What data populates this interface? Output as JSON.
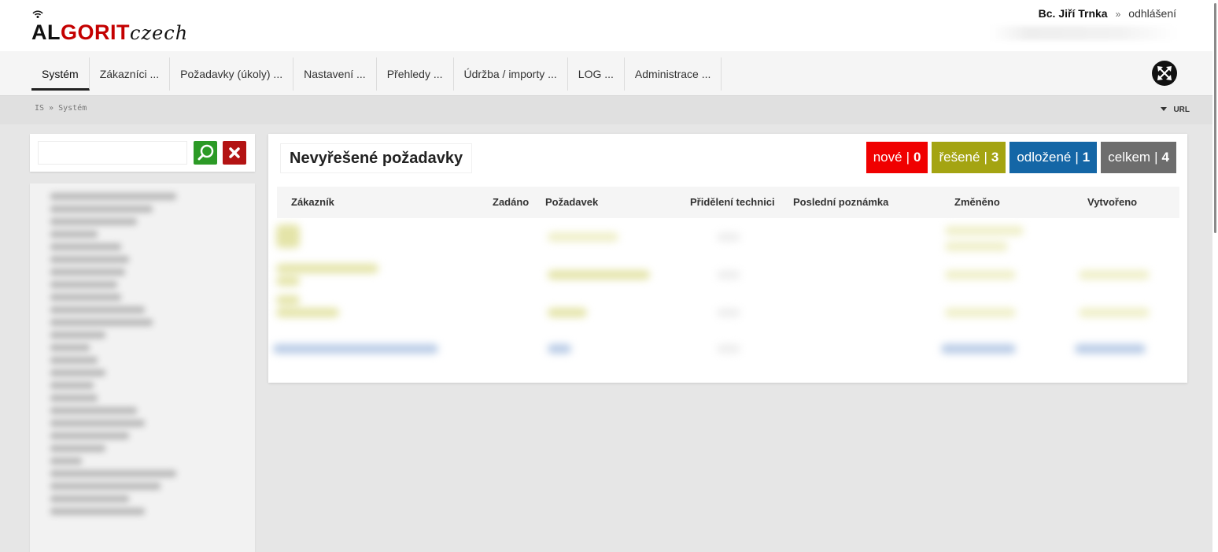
{
  "header": {
    "logo": {
      "part1": "AL",
      "part2": "GORIT",
      "part3": "czech"
    },
    "user_name": "Bc. Jiří Trnka",
    "separator": "»",
    "logout_label": "odhlášení"
  },
  "nav": {
    "items": [
      {
        "label": "Systém",
        "active": true
      },
      {
        "label": "Zákazníci ..."
      },
      {
        "label": "Požadavky (úkoly) ..."
      },
      {
        "label": "Nastavení ..."
      },
      {
        "label": "Přehledy ..."
      },
      {
        "label": "Údržba / importy ..."
      },
      {
        "label": "LOG ..."
      },
      {
        "label": "Administrace ..."
      }
    ]
  },
  "breadcrumb": {
    "text": "IS » Systém",
    "url_toggle": "URL"
  },
  "search": {
    "value": "",
    "placeholder": ""
  },
  "main": {
    "title": "Nevyřešené požadavky",
    "badges": [
      {
        "label": "nové",
        "count": "0",
        "color": "#f00000"
      },
      {
        "label": "řešené",
        "count": "3",
        "color": "#a4a412"
      },
      {
        "label": "odložené",
        "count": "1",
        "color": "#1466a6"
      },
      {
        "label": "celkem",
        "count": "4",
        "color": "#6d6d6d"
      }
    ],
    "columns": [
      "Zákazník",
      "Zadáno",
      "Požadavek",
      "Přidělení technici",
      "Poslední poznámka",
      "Změněno",
      "Vytvořeno"
    ]
  },
  "icons": {
    "search_button": "magnifier-icon",
    "clear_button": "x-icon",
    "fullscreen_button": "expand-arrows-icon",
    "url_toggle": "caret-down-icon"
  }
}
